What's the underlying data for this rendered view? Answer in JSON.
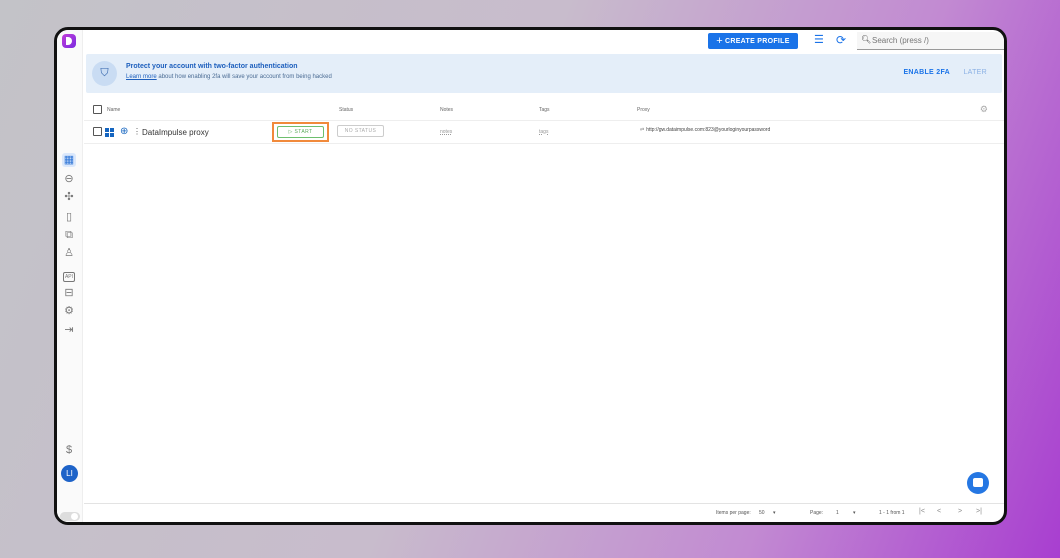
{
  "topbar": {
    "create_label": "CREATE PROFILE",
    "search_placeholder": "Search (press /)"
  },
  "banner": {
    "title": "Protect your account with two-factor authentication",
    "link_text": "Learn more",
    "text": " about how enabling 2fa will save your account from being hacked",
    "enable_label": "ENABLE 2FA",
    "later_label": "LATER"
  },
  "table": {
    "columns": [
      "Name",
      "Status",
      "Notes",
      "Tags",
      "Proxy"
    ],
    "rows": [
      {
        "name": "DataImpulse proxy",
        "start_label": "START",
        "status": "NO STATUS",
        "notes": "notes",
        "tags": "tags",
        "proxy": "http://gw.dataimpulse.com:823@yourloginyourpassword"
      }
    ]
  },
  "footer": {
    "items_per_page_label": "Items per page:",
    "items_per_page": "50",
    "page_label": "Page:",
    "page": "1",
    "range": "1 - 1 from 1"
  },
  "sidebar": {
    "avatar_initials": "LI",
    "api_label": "API"
  },
  "colors": {
    "accent": "#1a73e8",
    "start_green": "#5aaa5a",
    "highlight_orange": "#f18a3b"
  }
}
